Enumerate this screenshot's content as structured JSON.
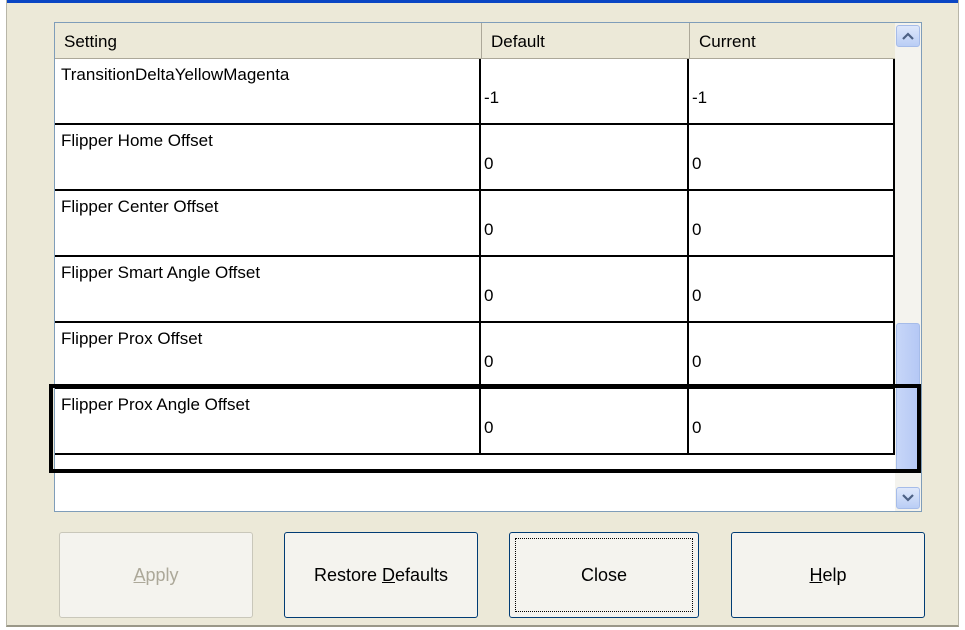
{
  "table": {
    "headers": {
      "setting": "Setting",
      "default": "Default",
      "current": "Current"
    },
    "rows": [
      {
        "setting": "TransitionDeltaYellowMagenta",
        "default": "-1",
        "current": "-1"
      },
      {
        "setting": "Flipper Home Offset",
        "default": "0",
        "current": "0"
      },
      {
        "setting": "Flipper Center Offset",
        "default": "0",
        "current": "0"
      },
      {
        "setting": "Flipper Smart Angle Offset",
        "default": "0",
        "current": "0"
      },
      {
        "setting": "Flipper Prox Offset",
        "default": "0",
        "current": "0"
      },
      {
        "setting": "Flipper Prox Angle Offset",
        "default": "0",
        "current": "0"
      }
    ]
  },
  "buttons": {
    "apply": {
      "prefix": "",
      "accel": "A",
      "rest": "pply"
    },
    "restore_defaults": {
      "prefix": "Restore ",
      "accel": "D",
      "rest": "efaults"
    },
    "close": "Close",
    "help": {
      "prefix": "",
      "accel": "H",
      "rest": "elp"
    }
  },
  "scrollbar": {
    "position_fraction": 1.0
  }
}
